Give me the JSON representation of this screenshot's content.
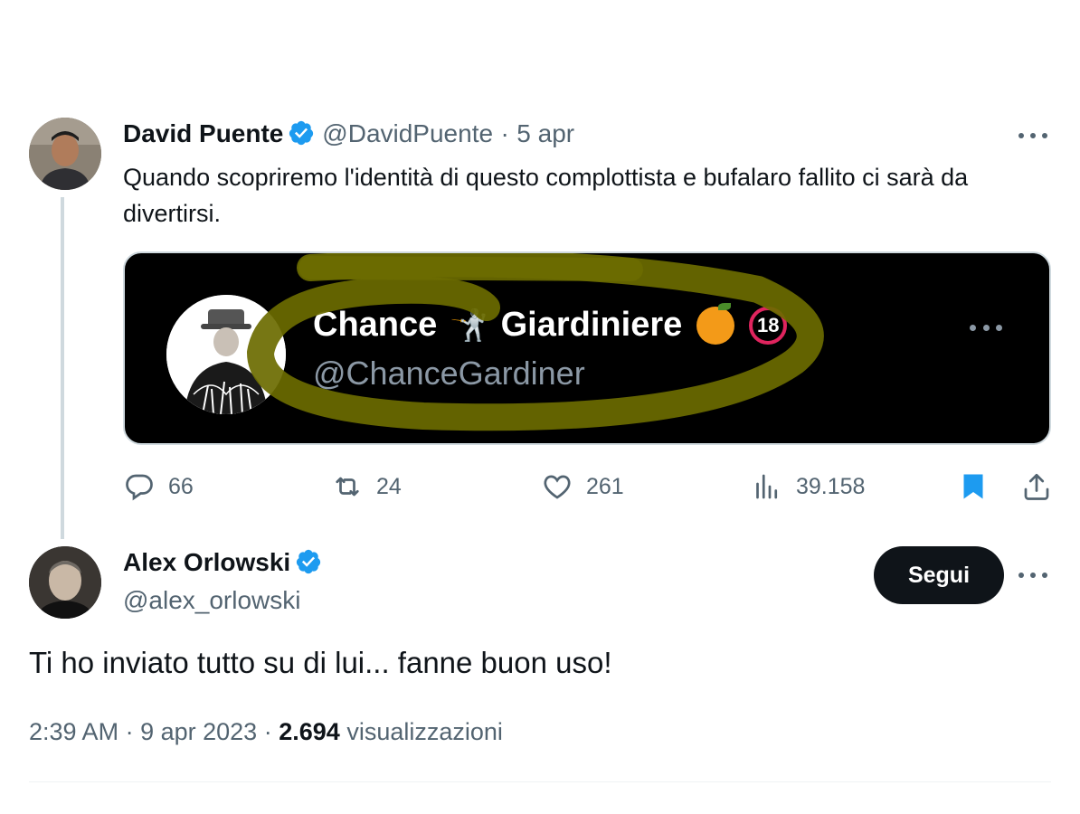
{
  "colors": {
    "text_primary": "#0f1419",
    "text_secondary": "#536471",
    "verified_blue": "#1d9bf0",
    "bookmark_blue": "#1d9bf0",
    "card_background": "#000000",
    "scribble": "#6b6b00",
    "follow_button": "#0f1419"
  },
  "tweet1": {
    "author_name": "David Puente",
    "author_handle": "@DavidPuente",
    "separator": "·",
    "date": "5 apr",
    "text": "Quando scopriremo l'identità di questo complottista e bufalaro fallito ci sarà da divertirsi.",
    "card": {
      "name_part1": "Chance",
      "name_part2": "Giardiniere",
      "age_badge": "18",
      "handle": "@ChanceGardiner"
    },
    "actions": {
      "replies": "66",
      "retweets": "24",
      "likes": "261",
      "views": "39.158"
    },
    "icons": [
      "reply-icon",
      "retweet-icon",
      "like-icon",
      "views-icon",
      "bookmark-icon",
      "share-icon",
      "more-icon",
      "verified-icon"
    ]
  },
  "tweet2": {
    "author_name": "Alex Orlowski",
    "author_handle": "@alex_orlowski",
    "follow_label": "Segui",
    "text": "Ti ho inviato tutto su di lui... fanne buon uso!",
    "time": "2:39 AM",
    "separator": "·",
    "date": "9 apr 2023",
    "views_count": "2.694",
    "views_label": "visualizzazioni"
  }
}
